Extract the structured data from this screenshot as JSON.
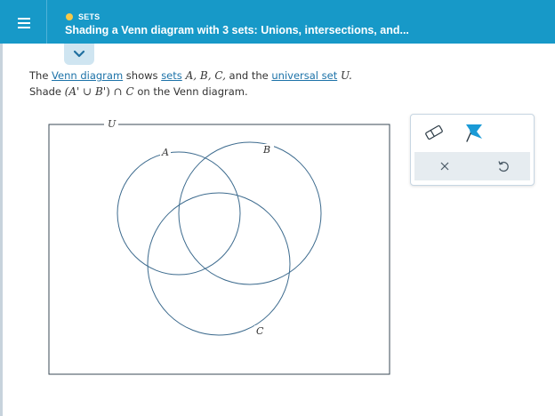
{
  "header": {
    "topic": "SETS",
    "title": "Shading a Venn diagram with 3 sets: Unions, intersections, and..."
  },
  "question": {
    "prefix": "The ",
    "venn_link": "Venn diagram",
    "shows": " shows ",
    "sets_link": "sets",
    "set_list": " A, B, C,",
    "and_the": " and the ",
    "universal_link": "universal set",
    "universal_symbol": " U.",
    "shade_prefix": "Shade ",
    "expr_open": "(A",
    "expr_prime1": "'",
    "expr_union": " ∪ ",
    "expr_b": "B",
    "expr_prime2": "'",
    "expr_close": ")",
    "expr_intersect": " ∩ ",
    "expr_c": "C",
    "shade_suffix": " on the Venn diagram."
  },
  "venn": {
    "universal_label": "U",
    "set_a_label": "A",
    "set_b_label": "B",
    "set_c_label": "C",
    "stroke_color": "#3d6b8e"
  },
  "toolbox": {
    "eraser_icon": "eraser-icon",
    "fill_icon": "fill-flag-icon",
    "clear_symbol": "×",
    "undo_icon": "undo-icon"
  },
  "colors": {
    "header_bg": "#1799c8",
    "topic_dot": "#f7c948",
    "link": "#1c72a8",
    "fill_tool": "#1a9ad6"
  }
}
